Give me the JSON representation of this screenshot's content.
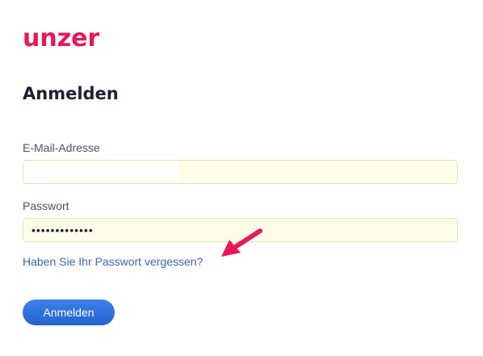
{
  "brand": {
    "logo_text": "unzer",
    "color": "#e8185a"
  },
  "page": {
    "title": "Anmelden"
  },
  "form": {
    "email_label": "E-Mail-Adresse",
    "email_value": "",
    "password_label": "Passwort",
    "password_value": "•••••••••••••",
    "forgot_link": "Haben Sie Ihr Passwort vergessen?",
    "submit_label": "Anmelden"
  },
  "annotation": {
    "icon": "arrow-icon",
    "color": "#e8185a"
  },
  "colors": {
    "link": "#3a64c0",
    "button": "#2a6ee0",
    "autofill_bg": "#fdfde8"
  }
}
